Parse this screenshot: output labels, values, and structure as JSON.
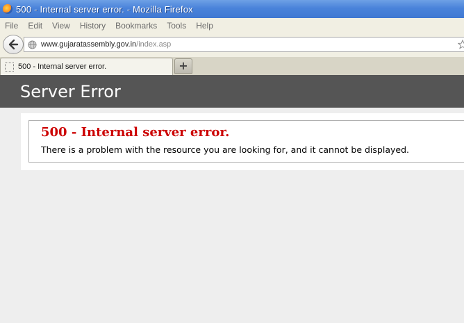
{
  "window": {
    "title": "500 - Internal server error. - Mozilla Firefox"
  },
  "menu": {
    "items": [
      "File",
      "Edit",
      "View",
      "History",
      "Bookmarks",
      "Tools",
      "Help"
    ]
  },
  "navigation": {
    "url_host": "www.gujaratassembly.gov.in",
    "url_path": "/index.asp"
  },
  "tabs": {
    "items": [
      {
        "label": "500 - Internal server error."
      }
    ],
    "new_tab_label": "+"
  },
  "page": {
    "header_title": "Server Error",
    "error_heading": "500 - Internal server error.",
    "error_message": "There is a problem with the resource you are looking for, and it cannot be displayed."
  },
  "colors": {
    "titlebar": "#4a83da",
    "header_band": "#555555",
    "error_heading": "#cc0000"
  },
  "icons": [
    "firefox-logo-icon",
    "back-arrow-icon",
    "globe-icon",
    "bookmark-star-icon",
    "tab-favicon-icon"
  ]
}
